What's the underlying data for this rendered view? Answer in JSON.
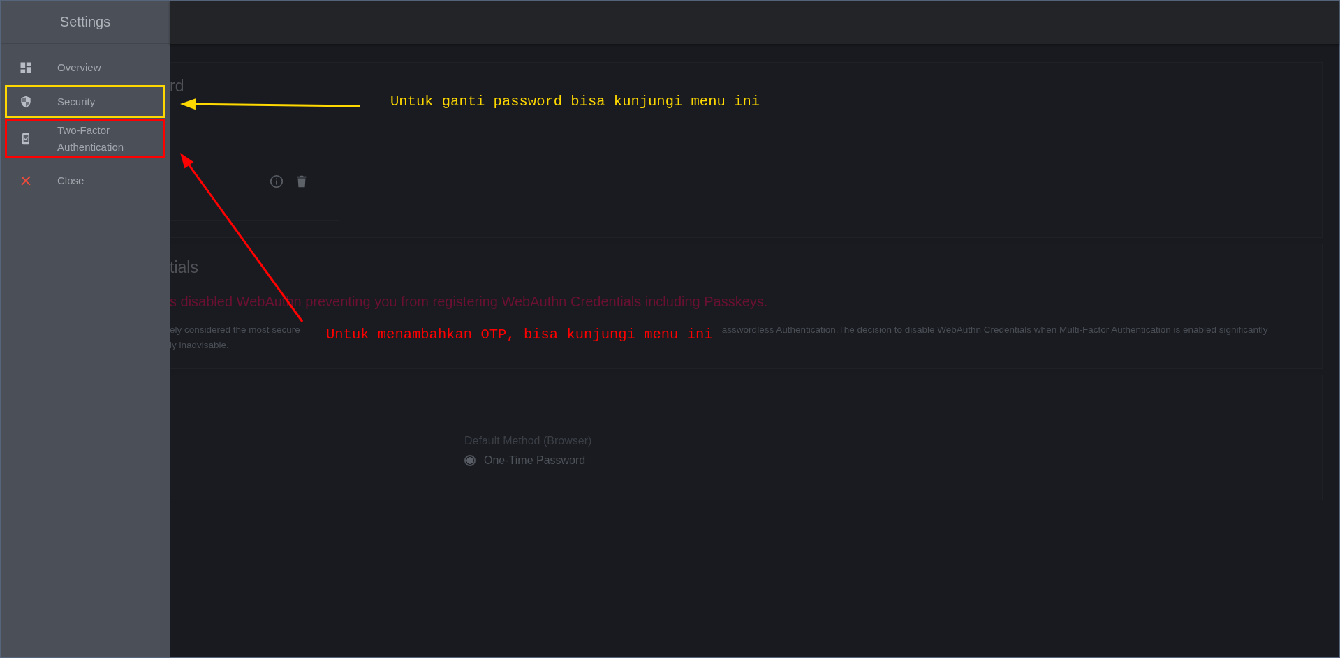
{
  "sidebar": {
    "title": "Settings",
    "items": [
      {
        "label": "Overview",
        "kind": "nav"
      },
      {
        "label": "Security",
        "kind": "nav",
        "color": "#ffd800"
      },
      {
        "label": "Two-Factor Authentication",
        "kind": "nav",
        "color": "#ff0000"
      },
      {
        "label": "Close",
        "kind": "close"
      }
    ]
  },
  "sections": [
    {
      "heading": "rd",
      "kind": "credential"
    },
    {
      "heading": "tials",
      "kind": "notice",
      "warning": "s disabled WebAuthn preventing you from registering WebAuthn Credentials including Passkeys.",
      "lines": [
        [
          "ely considered the most secure",
          "asswordless Authentication.The decision to disable WebAuthn Credentials when Multi-Factor Authentication is enabled significantly"
        ],
        [
          "ly inadvisable."
        ]
      ]
    },
    {
      "kind": "method",
      "label": "Default Method (Browser)",
      "options": [
        {
          "label": "One-Time Password",
          "selected": true
        }
      ]
    }
  ],
  "annotations": [
    {
      "text": "Untuk ganti password bisa kunjungi menu ini",
      "color": "#ffd800"
    },
    {
      "text": "Untuk menambahkan OTP, bisa kunjungi menu ini",
      "color": "#ff0000"
    }
  ]
}
